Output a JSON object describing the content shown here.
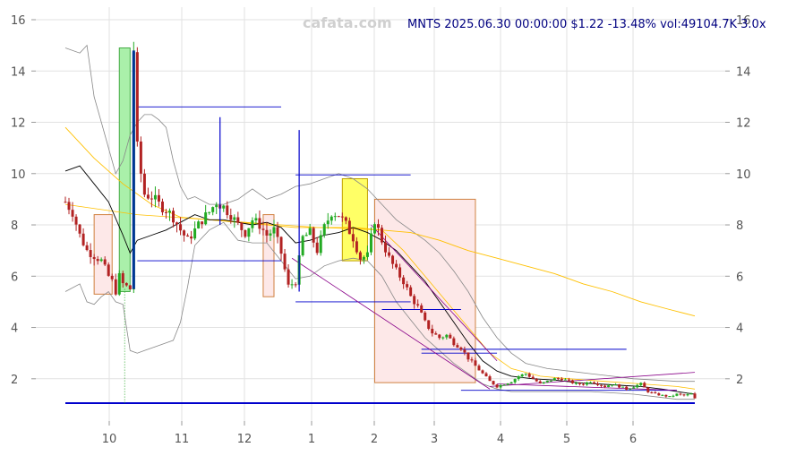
{
  "watermark": "cafata.com",
  "ticker_line": "MNTS 2025.06.30 00:00:00 $1.22 -13.48% vol:49104.7K 3.0x",
  "colors": {
    "up": "#22aa22",
    "down": "#b22222",
    "grid": "#e2e2e2",
    "ma_short": "#000000",
    "ma_long": "#ffc000",
    "bands": "#888888",
    "levels": "#0000cc",
    "trend": "#880088",
    "zone_pink_fill": "#fde8e8",
    "zone_pink_edge": "#d08040",
    "zone_yellow": "#ffff66",
    "zone_green": "#aaf0aa",
    "ticker_text": "#000080"
  },
  "chart_data": {
    "type": "candlestick",
    "x_ticks": [
      "10",
      "11",
      "12",
      "1",
      "2",
      "3",
      "4",
      "5",
      "6"
    ],
    "y_ticks": [
      "2",
      "4",
      "6",
      "8",
      "10",
      "12",
      "14",
      "16"
    ],
    "y_tick_values": [
      2,
      4,
      6,
      8,
      10,
      12,
      14,
      16
    ],
    "ylim": [
      0.9,
      16.5
    ],
    "x_range_months": [
      "2024-09",
      "2025-06-30"
    ],
    "close_path": [
      [
        0,
        8.9
      ],
      [
        2,
        8.5
      ],
      [
        4,
        7.6
      ],
      [
        6,
        7.0
      ],
      [
        8,
        6.8
      ],
      [
        10,
        6.6
      ],
      [
        12,
        6.0
      ],
      [
        13,
        5.8
      ],
      [
        14,
        5.4
      ],
      [
        15,
        6.0
      ],
      [
        16,
        5.7
      ],
      [
        18,
        5.5
      ],
      [
        19,
        14.8
      ],
      [
        20,
        11.0
      ],
      [
        21,
        10.0
      ],
      [
        22,
        9.2
      ],
      [
        24,
        9.1
      ],
      [
        26,
        8.8
      ],
      [
        28,
        8.6
      ],
      [
        30,
        8.3
      ],
      [
        32,
        7.8
      ],
      [
        34,
        7.4
      ],
      [
        36,
        7.8
      ],
      [
        38,
        8.2
      ],
      [
        40,
        8.5
      ],
      [
        42,
        8.9
      ],
      [
        44,
        8.7
      ],
      [
        46,
        8.4
      ],
      [
        48,
        8.0
      ],
      [
        50,
        7.7
      ],
      [
        52,
        8.2
      ],
      [
        54,
        8.0
      ],
      [
        56,
        7.6
      ],
      [
        58,
        7.8
      ],
      [
        60,
        6.9
      ],
      [
        62,
        5.6
      ],
      [
        64,
        5.8
      ],
      [
        66,
        7.5
      ],
      [
        68,
        7.7
      ],
      [
        70,
        7.0
      ],
      [
        72,
        7.9
      ],
      [
        74,
        8.5
      ],
      [
        76,
        8.4
      ],
      [
        78,
        8.0
      ],
      [
        80,
        7.5
      ],
      [
        82,
        6.7
      ],
      [
        84,
        6.8
      ],
      [
        86,
        8.2
      ],
      [
        88,
        7.4
      ],
      [
        90,
        6.7
      ],
      [
        92,
        6.2
      ],
      [
        94,
        5.8
      ],
      [
        96,
        5.2
      ],
      [
        98,
        4.8
      ],
      [
        100,
        4.2
      ],
      [
        102,
        3.8
      ],
      [
        104,
        3.6
      ],
      [
        106,
        3.7
      ],
      [
        108,
        3.4
      ],
      [
        110,
        3.2
      ],
      [
        112,
        2.8
      ],
      [
        114,
        2.5
      ],
      [
        116,
        2.2
      ],
      [
        118,
        1.9
      ],
      [
        120,
        1.7
      ],
      [
        122,
        1.8
      ],
      [
        124,
        1.9
      ],
      [
        126,
        2.1
      ],
      [
        128,
        2.2
      ],
      [
        130,
        2.0
      ],
      [
        132,
        1.8
      ],
      [
        134,
        1.9
      ],
      [
        136,
        2.0
      ],
      [
        138,
        2.0
      ],
      [
        140,
        1.9
      ],
      [
        142,
        1.8
      ],
      [
        144,
        1.8
      ],
      [
        146,
        1.9
      ],
      [
        148,
        1.8
      ],
      [
        150,
        1.7
      ],
      [
        152,
        1.8
      ],
      [
        154,
        1.7
      ],
      [
        156,
        1.6
      ],
      [
        158,
        1.7
      ],
      [
        160,
        1.8
      ],
      [
        162,
        1.5
      ],
      [
        164,
        1.4
      ],
      [
        166,
        1.35
      ],
      [
        168,
        1.3
      ],
      [
        170,
        1.4
      ],
      [
        172,
        1.35
      ],
      [
        174,
        1.41
      ],
      [
        175,
        1.22
      ]
    ],
    "ma_short": [
      [
        0,
        10.1
      ],
      [
        4,
        10.3
      ],
      [
        8,
        9.6
      ],
      [
        12,
        8.9
      ],
      [
        16,
        7.6
      ],
      [
        18,
        6.9
      ],
      [
        20,
        7.4
      ],
      [
        24,
        7.6
      ],
      [
        28,
        7.8
      ],
      [
        32,
        8.1
      ],
      [
        36,
        8.4
      ],
      [
        40,
        8.2
      ],
      [
        44,
        8.2
      ],
      [
        48,
        8.1
      ],
      [
        52,
        8.0
      ],
      [
        56,
        8.1
      ],
      [
        60,
        7.9
      ],
      [
        64,
        7.3
      ],
      [
        68,
        7.4
      ],
      [
        72,
        7.6
      ],
      [
        76,
        7.7
      ],
      [
        80,
        7.9
      ],
      [
        84,
        7.7
      ],
      [
        88,
        7.4
      ],
      [
        92,
        7.0
      ],
      [
        96,
        6.4
      ],
      [
        100,
        5.8
      ],
      [
        104,
        5.0
      ],
      [
        108,
        4.2
      ],
      [
        112,
        3.4
      ],
      [
        116,
        2.7
      ],
      [
        120,
        2.3
      ],
      [
        124,
        2.1
      ],
      [
        130,
        2.0
      ],
      [
        136,
        1.95
      ],
      [
        142,
        1.85
      ],
      [
        148,
        1.8
      ],
      [
        154,
        1.75
      ],
      [
        160,
        1.7
      ],
      [
        166,
        1.6
      ],
      [
        170,
        1.5
      ],
      [
        175,
        1.4
      ]
    ],
    "ma_long": [
      [
        0,
        11.8
      ],
      [
        8,
        10.6
      ],
      [
        16,
        9.6
      ],
      [
        24,
        8.8
      ],
      [
        32,
        8.3
      ],
      [
        40,
        8.2
      ],
      [
        48,
        8.1
      ],
      [
        56,
        8.0
      ],
      [
        64,
        7.9
      ],
      [
        72,
        7.9
      ],
      [
        80,
        7.9
      ],
      [
        88,
        7.8
      ],
      [
        96,
        7.7
      ],
      [
        104,
        7.4
      ],
      [
        112,
        7.0
      ],
      [
        120,
        6.7
      ],
      [
        128,
        6.4
      ],
      [
        136,
        6.1
      ],
      [
        144,
        5.7
      ],
      [
        152,
        5.4
      ],
      [
        160,
        5.0
      ],
      [
        168,
        4.7
      ],
      [
        175,
        4.45
      ]
    ],
    "ma_mid": [
      [
        0,
        8.8
      ],
      [
        10,
        8.6
      ],
      [
        20,
        8.4
      ],
      [
        30,
        8.3
      ],
      [
        40,
        8.2
      ],
      [
        50,
        8.1
      ],
      [
        60,
        8.0
      ],
      [
        70,
        7.9
      ],
      [
        80,
        7.85
      ],
      [
        88,
        7.8
      ],
      [
        94,
        7.0
      ],
      [
        100,
        6.0
      ],
      [
        106,
        5.0
      ],
      [
        112,
        4.0
      ],
      [
        118,
        3.0
      ],
      [
        124,
        2.4
      ],
      [
        132,
        2.1
      ],
      [
        140,
        2.0
      ],
      [
        150,
        1.9
      ],
      [
        160,
        1.8
      ],
      [
        170,
        1.7
      ],
      [
        175,
        1.6
      ]
    ],
    "band_upper": [
      [
        0,
        14.9
      ],
      [
        4,
        14.7
      ],
      [
        6,
        15.0
      ],
      [
        8,
        13.0
      ],
      [
        10,
        12.0
      ],
      [
        12,
        11.0
      ],
      [
        14,
        10.0
      ],
      [
        16,
        10.5
      ],
      [
        18,
        11.5
      ],
      [
        20,
        12.0
      ],
      [
        22,
        12.3
      ],
      [
        24,
        12.3
      ],
      [
        26,
        12.1
      ],
      [
        28,
        11.8
      ],
      [
        30,
        10.5
      ],
      [
        32,
        9.5
      ],
      [
        34,
        9.0
      ],
      [
        36,
        9.1
      ],
      [
        40,
        8.8
      ],
      [
        44,
        8.8
      ],
      [
        48,
        9.0
      ],
      [
        52,
        9.4
      ],
      [
        56,
        9.0
      ],
      [
        60,
        9.2
      ],
      [
        64,
        9.5
      ],
      [
        68,
        9.6
      ],
      [
        72,
        9.8
      ],
      [
        76,
        10.0
      ],
      [
        80,
        9.8
      ],
      [
        84,
        9.4
      ],
      [
        88,
        8.8
      ],
      [
        92,
        8.2
      ],
      [
        96,
        7.8
      ],
      [
        100,
        7.4
      ],
      [
        104,
        6.9
      ],
      [
        108,
        6.2
      ],
      [
        112,
        5.4
      ],
      [
        116,
        4.4
      ],
      [
        120,
        3.6
      ],
      [
        124,
        3.0
      ],
      [
        128,
        2.6
      ],
      [
        134,
        2.4
      ],
      [
        140,
        2.3
      ],
      [
        146,
        2.2
      ],
      [
        152,
        2.1
      ],
      [
        158,
        2.0
      ],
      [
        164,
        1.95
      ],
      [
        170,
        1.9
      ],
      [
        175,
        1.9
      ]
    ],
    "band_lower": [
      [
        0,
        5.4
      ],
      [
        4,
        5.7
      ],
      [
        6,
        5.0
      ],
      [
        8,
        4.9
      ],
      [
        10,
        5.2
      ],
      [
        12,
        5.4
      ],
      [
        14,
        5.0
      ],
      [
        16,
        4.9
      ],
      [
        18,
        3.1
      ],
      [
        20,
        3.0
      ],
      [
        22,
        3.1
      ],
      [
        26,
        3.3
      ],
      [
        30,
        3.5
      ],
      [
        32,
        4.2
      ],
      [
        34,
        5.6
      ],
      [
        36,
        7.2
      ],
      [
        40,
        7.8
      ],
      [
        44,
        8.1
      ],
      [
        48,
        7.4
      ],
      [
        52,
        7.3
      ],
      [
        56,
        7.3
      ],
      [
        60,
        6.6
      ],
      [
        64,
        5.9
      ],
      [
        68,
        6.0
      ],
      [
        72,
        6.4
      ],
      [
        76,
        6.6
      ],
      [
        80,
        6.7
      ],
      [
        84,
        6.6
      ],
      [
        88,
        6.0
      ],
      [
        92,
        5.0
      ],
      [
        96,
        4.3
      ],
      [
        100,
        3.6
      ],
      [
        104,
        3.1
      ],
      [
        108,
        2.6
      ],
      [
        112,
        2.2
      ],
      [
        116,
        1.8
      ],
      [
        120,
        1.6
      ],
      [
        124,
        1.5
      ],
      [
        128,
        1.5
      ],
      [
        134,
        1.5
      ],
      [
        140,
        1.5
      ],
      [
        146,
        1.5
      ],
      [
        152,
        1.45
      ],
      [
        158,
        1.4
      ],
      [
        164,
        1.3
      ],
      [
        170,
        1.2
      ],
      [
        175,
        1.2
      ]
    ],
    "levels": [
      {
        "y": 12.6,
        "x0": 20,
        "x1": 60
      },
      {
        "y": 6.6,
        "x0": 20,
        "x1": 60
      },
      {
        "y": 9.95,
        "x0": 64,
        "x1": 96
      },
      {
        "y": 5.0,
        "x0": 64,
        "x1": 96
      },
      {
        "y": 4.7,
        "x0": 88,
        "x1": 110
      },
      {
        "y": 3.15,
        "x0": 99,
        "x1": 156
      },
      {
        "y": 3.0,
        "x0": 99,
        "x1": 120
      },
      {
        "y": 1.55,
        "x0": 110,
        "x1": 170
      },
      {
        "y": 1.05,
        "x0": 0,
        "x1": 175
      }
    ],
    "trend_lines": [
      {
        "x0": 63,
        "y0": 6.7,
        "x1": 118,
        "y1": 1.6
      },
      {
        "x0": 85,
        "y0": 8.0,
        "x1": 120,
        "y1": 2.7
      },
      {
        "x0": 118,
        "y0": 1.7,
        "x1": 175,
        "y1": 2.25
      },
      {
        "x0": 120,
        "y0": 1.8,
        "x1": 170,
        "y1": 1.55
      }
    ],
    "zones": [
      {
        "kind": "pink",
        "x0": 8,
        "x1": 13,
        "y0": 5.3,
        "y1": 8.4
      },
      {
        "kind": "green",
        "x0": 15,
        "x1": 18,
        "y0": 5.4,
        "y1": 14.9
      },
      {
        "kind": "pink",
        "x0": 55,
        "x1": 58,
        "y0": 5.2,
        "y1": 8.4
      },
      {
        "kind": "yellow",
        "x0": 77,
        "x1": 84,
        "y0": 6.6,
        "y1": 9.8
      },
      {
        "kind": "pink",
        "x0": 86,
        "x1": 114,
        "y0": 1.85,
        "y1": 9.0
      }
    ],
    "spikes": [
      {
        "x": 19,
        "y0": 5.5,
        "y1": 14.8
      },
      {
        "x": 43,
        "y0": 8.0,
        "y1": 12.2
      },
      {
        "x": 65,
        "y0": 5.4,
        "y1": 11.7
      }
    ]
  }
}
